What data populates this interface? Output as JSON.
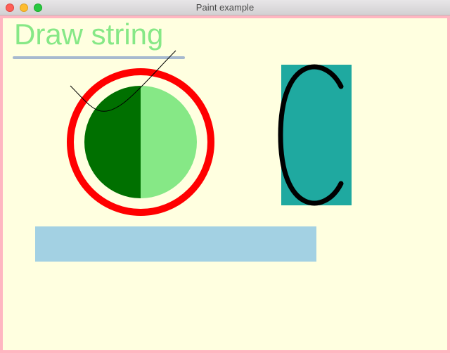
{
  "window": {
    "title": "Paint example"
  },
  "canvas": {
    "background": "#ffffe0",
    "border_color": "#ffb6c1",
    "heading": {
      "text": "Draw string",
      "color": "#86e886"
    },
    "colors": {
      "underline": "#a7b9cf",
      "ring": "#ff0000",
      "circle_left": "#007000",
      "circle_right": "#86e886",
      "curve": "#000000",
      "teal_rect": "#1fa9a0",
      "arc": "#000000",
      "blue_rect": "#a3d1e3"
    }
  }
}
